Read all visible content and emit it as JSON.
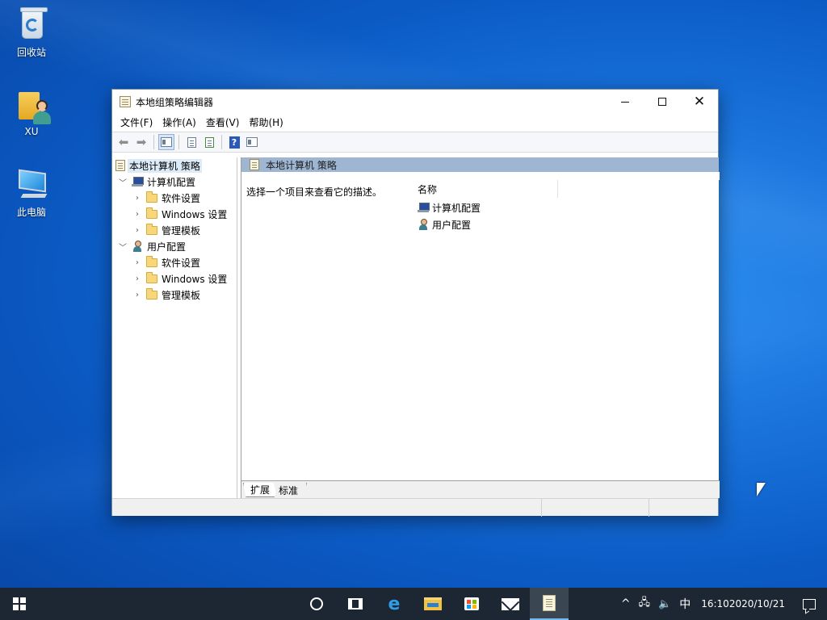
{
  "desktop": {
    "icons": [
      {
        "label": "回收站",
        "icon": "recycle-bin-icon"
      },
      {
        "label": "XU",
        "icon": "user-folder-icon"
      },
      {
        "label": "此电脑",
        "icon": "this-pc-icon"
      }
    ]
  },
  "window": {
    "title": "本地组策略编辑器",
    "menu": [
      "文件(F)",
      "操作(A)",
      "查看(V)",
      "帮助(H)"
    ],
    "toolbar": [
      "back-arrow-icon",
      "forward-arrow-icon",
      "show-hide-tree-icon",
      "properties-icon",
      "export-list-icon",
      "help-icon",
      "show-hide-action-pane-icon"
    ],
    "tree": {
      "root": "本地计算机 策略",
      "computer_config": {
        "label": "计算机配置",
        "children": [
          "软件设置",
          "Windows 设置",
          "管理模板"
        ]
      },
      "user_config": {
        "label": "用户配置",
        "children": [
          "软件设置",
          "Windows 设置",
          "管理模板"
        ]
      }
    },
    "content": {
      "header": "本地计算机 策略",
      "description": "选择一个项目来查看它的描述。",
      "column_name": "名称",
      "items": [
        "计算机配置",
        "用户配置"
      ],
      "tabs": [
        "扩展",
        "标准"
      ]
    }
  },
  "taskbar": {
    "apps": [
      "start-icon",
      "cortana-icon",
      "task-view-icon",
      "edge-icon",
      "file-explorer-icon",
      "store-icon",
      "mail-icon",
      "group-policy-editor-icon"
    ],
    "tray": {
      "chevron": "^",
      "ime": "中",
      "time": "16:10",
      "date": "2020/10/21"
    }
  },
  "colors": {
    "desktop_accent": "#1a74dc",
    "taskbar_bg": "#1d2733",
    "content_header_bg": "#9fb6d3",
    "selection_bg": "#dcebf8"
  }
}
